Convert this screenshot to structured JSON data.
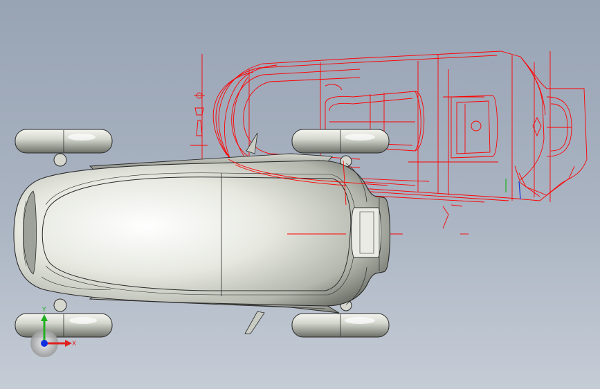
{
  "viewport": {
    "background_top": "#98a3b4",
    "background_bottom": "#c5ccd6"
  },
  "model": {
    "body_color": "#e4e6df",
    "body_shade": "#8a8d84",
    "edge_color": "#2a2a2a",
    "sketch_color": "#ff0000"
  },
  "triad": {
    "x_label": "X",
    "y_label": "Y",
    "x_color": "#e02020",
    "y_color": "#20b020",
    "z_color": "#1030e0"
  }
}
